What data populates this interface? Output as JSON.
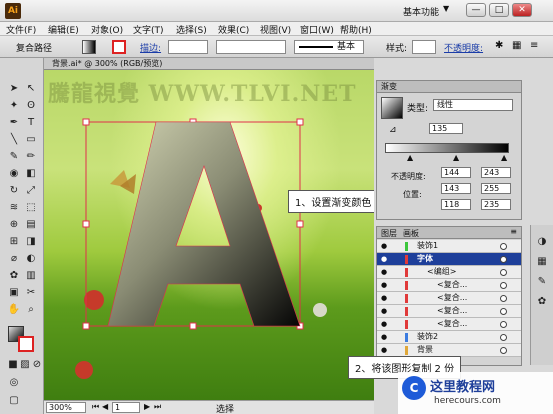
{
  "app": {
    "logo": "Ai",
    "workspace": "基本功能",
    "window_buttons": [
      "—",
      "□",
      "✕"
    ]
  },
  "menu": [
    "文件(F)",
    "编辑(E)",
    "对象(O)",
    "文字(T)",
    "选择(S)",
    "效果(C)",
    "视图(V)",
    "窗口(W)",
    "帮助(H)"
  ],
  "control": {
    "selection_type": "复合路径",
    "stroke_label": "描边:",
    "style_label": "样式:",
    "brush_preset": "基本",
    "opacity_label": "不透明度:"
  },
  "document": {
    "tab_title": "背景.ai* @ 300% (RGB/预览)",
    "zoom": "300%",
    "page": "1",
    "status": "选择",
    "watermark": "騰龍視覺 WWW.TLVI.NET"
  },
  "gradient_panel": {
    "tab": "渐变",
    "type_label": "类型:",
    "type_value": "线性",
    "angle": "135",
    "opacity_label": "不透明度:",
    "location_label": "位置:",
    "rgb_left": [
      "144",
      "143",
      "118"
    ],
    "rgb_right": [
      "243",
      "255",
      "235"
    ]
  },
  "layers_panel": {
    "tabs": [
      "图层",
      "画板"
    ],
    "rows": [
      {
        "name": "装饰1",
        "color": "#3cc63c",
        "indent": 0,
        "selected": false
      },
      {
        "name": "字体",
        "color": "#e03a3a",
        "indent": 0,
        "selected": true
      },
      {
        "name": "<编组>",
        "color": "#e03a3a",
        "indent": 1,
        "selected": false
      },
      {
        "name": "<复合...",
        "color": "#e03a3a",
        "indent": 2,
        "selected": false
      },
      {
        "name": "<复合...",
        "color": "#e03a3a",
        "indent": 2,
        "selected": false
      },
      {
        "name": "<复合...",
        "color": "#e03a3a",
        "indent": 2,
        "selected": false
      },
      {
        "name": "<复合...",
        "color": "#e03a3a",
        "indent": 2,
        "selected": false
      },
      {
        "name": "装饰2",
        "color": "#3c7ce0",
        "indent": 0,
        "selected": false
      },
      {
        "name": "背景",
        "color": "#e0a83a",
        "indent": 0,
        "selected": false
      }
    ]
  },
  "callouts": {
    "one": "1、设置渐变颜色",
    "two": "2、将该图形复制 2 份"
  },
  "site_logo": {
    "name": "这里教程网",
    "url": "herecours.com"
  }
}
